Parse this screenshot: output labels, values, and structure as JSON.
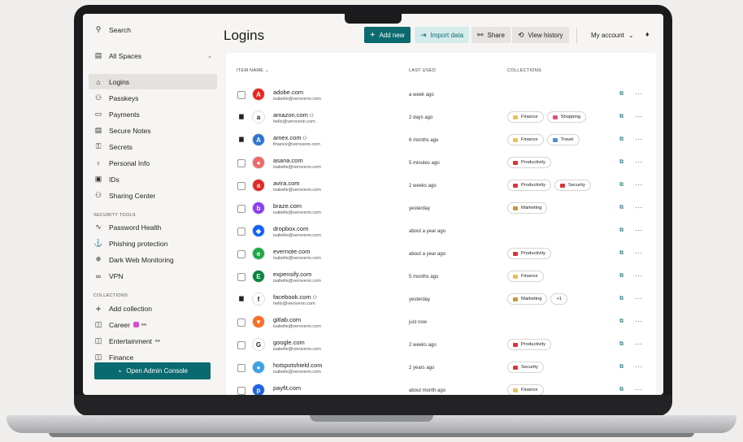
{
  "sidebar": {
    "search": "Search",
    "spaces": "All Spaces",
    "items": [
      {
        "label": "Logins",
        "icon": "lock-icon"
      },
      {
        "label": "Passkeys",
        "icon": "passkey-icon"
      },
      {
        "label": "Payments",
        "icon": "card-icon"
      },
      {
        "label": "Secure Notes",
        "icon": "note-icon"
      },
      {
        "label": "Secrets",
        "icon": "key-icon"
      },
      {
        "label": "Personal Info",
        "icon": "person-icon"
      },
      {
        "label": "IDs",
        "icon": "id-icon"
      },
      {
        "label": "Sharing Center",
        "icon": "sharing-icon"
      }
    ],
    "security_heading": "SECURITY TOOLS",
    "security_items": [
      {
        "label": "Password Health",
        "icon": "pulse-icon"
      },
      {
        "label": "Phishing protection",
        "icon": "phishing-icon"
      },
      {
        "label": "Dark Web Monitoring",
        "icon": "darkweb-icon"
      },
      {
        "label": "VPN",
        "icon": "vpn-icon"
      }
    ],
    "collections_heading": "COLLECTIONS",
    "add_collection": "Add collection",
    "collections": [
      "Career",
      "Entertainment",
      "Finance"
    ],
    "admin_button": "Open Admin Console"
  },
  "header": {
    "title": "Logins",
    "add_new": "Add new",
    "import": "Import data",
    "share": "Share",
    "history": "View history",
    "account": "My account"
  },
  "table": {
    "columns": [
      "ITEM NAME",
      "LAST USED",
      "COLLECTIONS"
    ],
    "rows": [
      {
        "name": "adobe.com",
        "email": "isabelle@verovenn.com",
        "used": "a week ago",
        "shared": false,
        "locked": false,
        "tags": [],
        "logo": "A",
        "color": "#e8261f"
      },
      {
        "name": "amazon.com",
        "email": "hello@verovenn.com",
        "used": "2 days ago",
        "shared": true,
        "locked": true,
        "tags": [
          "Finance",
          "Shopping"
        ],
        "logo": "a",
        "color": "#ffffff"
      },
      {
        "name": "amex.com",
        "email": "finance@verovenn.com",
        "used": "6 months ago",
        "shared": true,
        "locked": true,
        "tags": [
          "Finance",
          "Travel"
        ],
        "logo": "A",
        "color": "#2e77d0"
      },
      {
        "name": "asana.com",
        "email": "isabelle@verovenn.com",
        "used": "5 minutes ago",
        "shared": false,
        "locked": false,
        "tags": [
          "Productivity"
        ],
        "logo": "●",
        "color": "#f06a6a"
      },
      {
        "name": "avira.com",
        "email": "isabelle@verovenn.com",
        "used": "2 weeks ago",
        "shared": false,
        "locked": false,
        "tags": [
          "Productivity",
          "Security"
        ],
        "logo": "a",
        "color": "#e02a27"
      },
      {
        "name": "braze.com",
        "email": "isabelle@verovenn.com",
        "used": "yesterday",
        "shared": false,
        "locked": false,
        "tags": [
          "Marketing"
        ],
        "logo": "b",
        "color": "#8a3ef0"
      },
      {
        "name": "dropbox.com",
        "email": "isabelle@verovenn.com",
        "used": "about a year ago",
        "shared": false,
        "locked": false,
        "tags": [],
        "logo": "◆",
        "color": "#0d62ff"
      },
      {
        "name": "evernote.com",
        "email": "isabelle@verovenn.com",
        "used": "about a year ago",
        "shared": false,
        "locked": false,
        "tags": [
          "Productivity"
        ],
        "logo": "e",
        "color": "#1fa94a"
      },
      {
        "name": "expensify.com",
        "email": "isabelle@verovenn.com",
        "used": "5 months ago",
        "shared": false,
        "locked": false,
        "tags": [
          "Finance"
        ],
        "logo": "E",
        "color": "#08853f"
      },
      {
        "name": "facebook.com",
        "email": "hello@verovenn.com",
        "used": "yesterday",
        "shared": true,
        "locked": true,
        "tags": [
          "Marketing",
          "+1"
        ],
        "logo": "f",
        "color": "#ffffff"
      },
      {
        "name": "gitlab.com",
        "email": "isabelle@verovenn.com",
        "used": "just now",
        "shared": false,
        "locked": false,
        "tags": [],
        "logo": "▼",
        "color": "#fc6d26"
      },
      {
        "name": "google.com",
        "email": "isabelle@verovenn.com",
        "used": "2 weeks ago",
        "shared": false,
        "locked": false,
        "tags": [
          "Productivity"
        ],
        "logo": "G",
        "color": "#ffffff"
      },
      {
        "name": "hotspotshield.com",
        "email": "isabelle@verovenn.com",
        "used": "2 years ago",
        "shared": false,
        "locked": false,
        "tags": [
          "Security"
        ],
        "logo": "●",
        "color": "#3aa2e6"
      },
      {
        "name": "payfit.com",
        "email": "",
        "used": "about month ago",
        "shared": false,
        "locked": false,
        "tags": [
          "Finance"
        ],
        "logo": "p",
        "color": "#1f63e6"
      }
    ]
  },
  "tag_colors": {
    "Finance": "#e7c15a",
    "Shopping": "#e05577",
    "Travel": "#4d8ed8",
    "Productivity": "#d9363b",
    "Security": "#d9363b",
    "Marketing": "#c8963a"
  },
  "colors": {
    "accent": "#0b6a6f",
    "accent_light": "#d6ecec"
  }
}
